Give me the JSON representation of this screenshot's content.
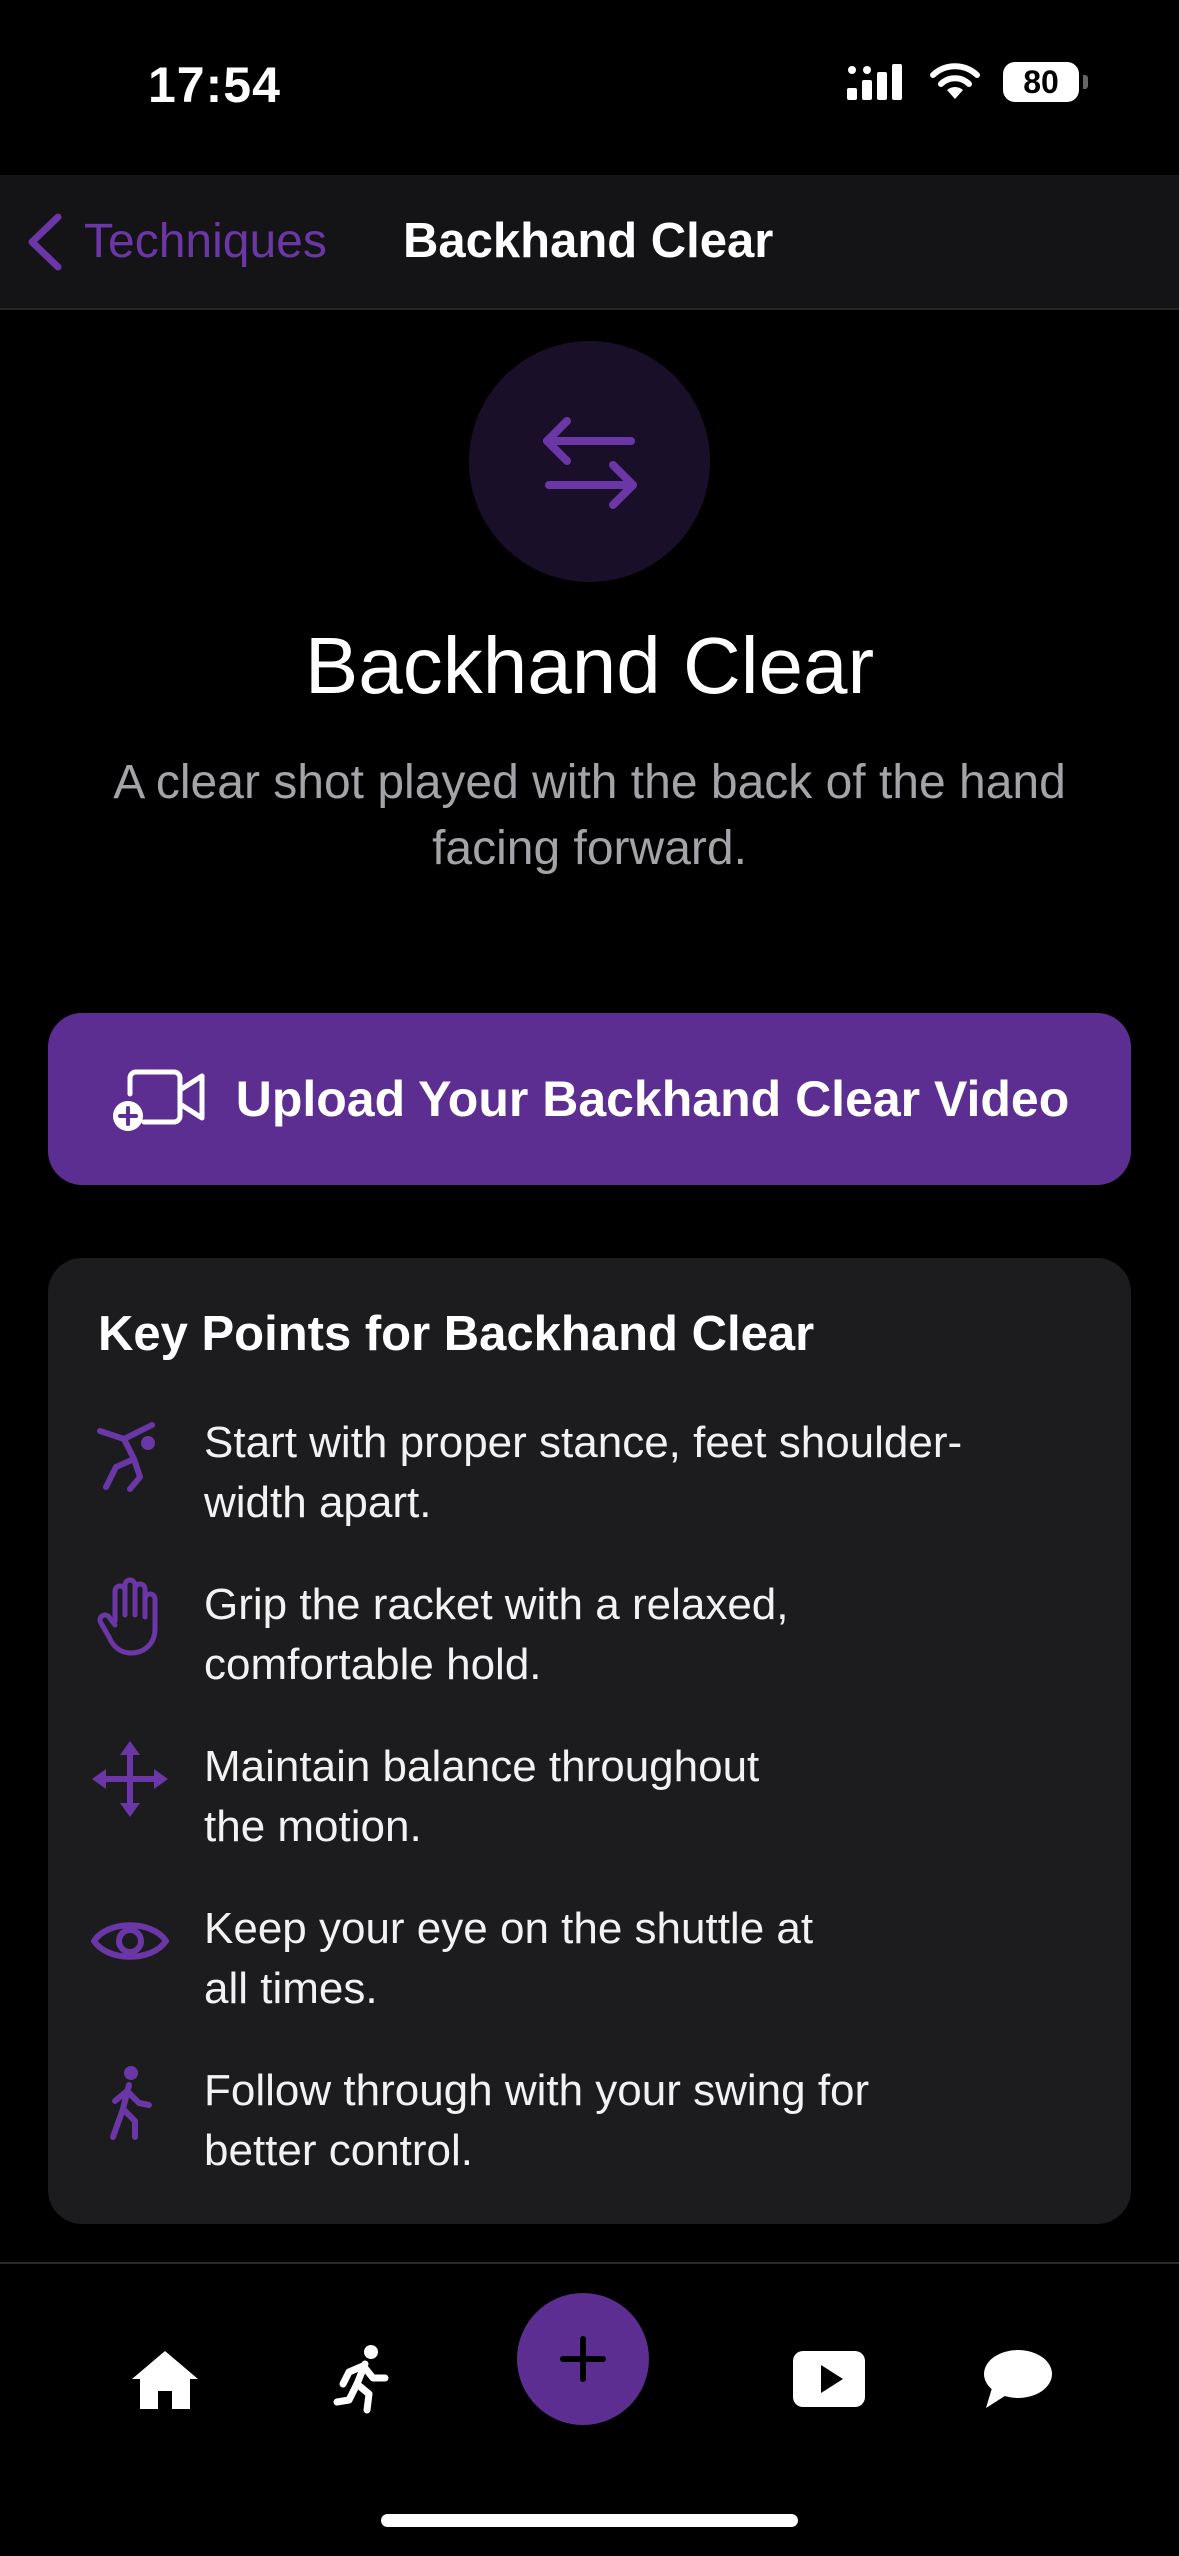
{
  "status": {
    "time": "17:54",
    "battery": "80"
  },
  "nav": {
    "back_label": "Techniques",
    "title": "Backhand Clear"
  },
  "hero": {
    "icon": "arrows-left-right-icon",
    "title": "Backhand Clear",
    "subtitle": "A clear shot played with the back of the hand facing forward."
  },
  "upload": {
    "label": "Upload Your Backhand Clear Video",
    "icon": "video-plus-icon"
  },
  "key_points": {
    "title": "Key Points for Backhand Clear",
    "items": [
      {
        "icon": "stance-figure-icon",
        "line1": "Start with proper stance, feet shoulder-",
        "line2": "width apart."
      },
      {
        "icon": "hand-icon",
        "line1": "Grip the racket with a relaxed,",
        "line2": "comfortable hold."
      },
      {
        "icon": "move-arrows-icon",
        "line1": "Maintain balance throughout",
        "line2": "the motion."
      },
      {
        "icon": "eye-icon",
        "line1": "Keep your eye on the shuttle at",
        "line2": "all times."
      },
      {
        "icon": "walking-figure-icon",
        "line1": "Follow through with your swing for",
        "line2": "better control."
      }
    ]
  },
  "tabbar": {
    "tabs": [
      "home-icon",
      "running-icon",
      "plus-icon",
      "play-icon",
      "chat-bubble-icon"
    ]
  },
  "colors": {
    "accent": "#5c2e91",
    "background": "#000000",
    "card": "#1c1c1e",
    "muted_text": "#a4a4a8"
  }
}
